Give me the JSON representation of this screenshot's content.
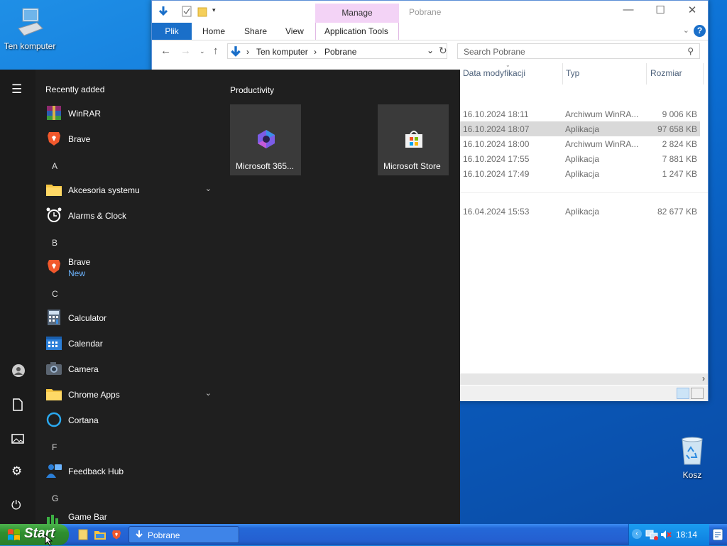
{
  "desktop": {
    "computer_label": "Ten komputer",
    "recycle_label": "Kosz"
  },
  "explorer": {
    "title": "Pobrane",
    "manage_tab": "Manage",
    "tabs": [
      "Plik",
      "Home",
      "Share",
      "View",
      "Application Tools"
    ],
    "path": [
      "Ten komputer",
      "Pobrane"
    ],
    "search_placeholder": "Search Pobrane",
    "columns": [
      "Data modyfikacji",
      "Typ",
      "Rozmiar"
    ],
    "rows": [
      {
        "date": "16.10.2024 18:11",
        "type": "Archiwum WinRA...",
        "size": "9 006 KB"
      },
      {
        "date": "16.10.2024 18:07",
        "type": "Aplikacja",
        "size": "97 658 KB"
      },
      {
        "date": "16.10.2024 18:00",
        "type": "Archiwum WinRA...",
        "size": "2 824 KB"
      },
      {
        "date": "16.10.2024 17:55",
        "type": "Aplikacja",
        "size": "7 881 KB"
      },
      {
        "date": "16.10.2024 17:49",
        "type": "Aplikacja",
        "size": "1 247 KB"
      },
      {
        "date": "16.04.2024 15:53",
        "type": "Aplikacja",
        "size": "82 677 KB"
      }
    ]
  },
  "startmenu": {
    "recently_added": "Recently added",
    "productivity": "Productivity",
    "apps": {
      "winrar": "WinRAR",
      "brave_recent": "Brave",
      "letter_a": "A",
      "akcesoria": "Akcesoria systemu",
      "alarms": "Alarms & Clock",
      "letter_b": "B",
      "brave": "Brave",
      "brave_new": "New",
      "letter_c": "C",
      "calculator": "Calculator",
      "calendar": "Calendar",
      "camera": "Camera",
      "chrome_apps": "Chrome Apps",
      "cortana": "Cortana",
      "letter_f": "F",
      "feedback": "Feedback Hub",
      "letter_g": "G",
      "gamebar": "Game Bar"
    },
    "tiles": {
      "m365": "Microsoft 365...",
      "store": "Microsoft Store"
    }
  },
  "taskbar": {
    "start_label": "Start",
    "task_label": "Pobrane",
    "clock": "18:14"
  }
}
